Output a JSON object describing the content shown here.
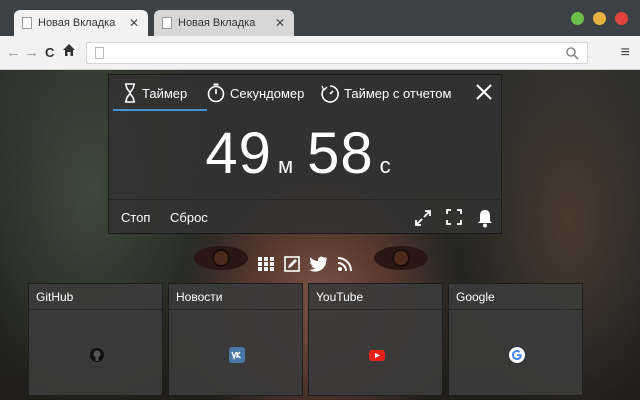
{
  "tabs": [
    {
      "label": "Новая Вкладка",
      "active": true
    },
    {
      "label": "Новая Вкладка",
      "active": false
    }
  ],
  "tab_close_glyph": "✕",
  "window_buttons": [
    {
      "name": "maximize",
      "color": "#6cbf4b"
    },
    {
      "name": "minimize",
      "color": "#e6b13c"
    },
    {
      "name": "close",
      "color": "#e0443e"
    }
  ],
  "toolbar": {
    "back_glyph": "←",
    "forward_glyph": "→",
    "reload_glyph": "C",
    "menu_glyph": "≡",
    "url_value": ""
  },
  "timer": {
    "tabs": [
      {
        "label": "Таймер",
        "icon": "hourglass-icon",
        "active": true
      },
      {
        "label": "Секундомер",
        "icon": "stopwatch-icon",
        "active": false
      },
      {
        "label": "Таймер с отчетом",
        "icon": "countdown-icon",
        "active": false
      }
    ],
    "minutes": "49",
    "minutes_unit": "м",
    "seconds": "58",
    "seconds_unit": "с",
    "stop_label": "Стоп",
    "reset_label": "Сброс",
    "accent": "#4a90d9"
  },
  "social_icons": [
    "grid-icon",
    "edit-icon",
    "twitter-icon",
    "rss-icon"
  ],
  "speed_dial": [
    {
      "title": "GitHub",
      "icon": "github-icon"
    },
    {
      "title": "Новости",
      "icon": "vk-icon"
    },
    {
      "title": "YouTube",
      "icon": "youtube-icon"
    },
    {
      "title": "Google",
      "icon": "google-icon"
    }
  ]
}
